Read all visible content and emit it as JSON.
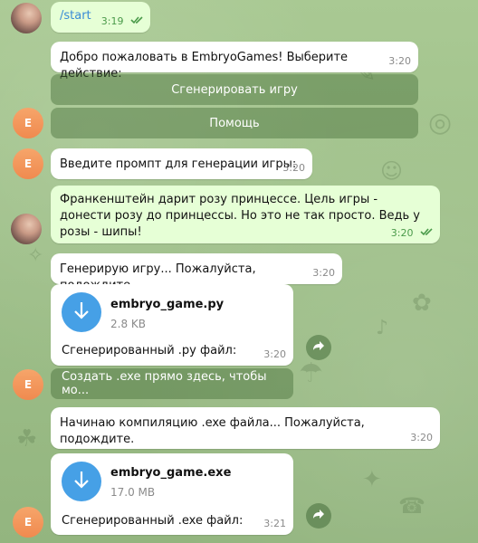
{
  "chat": {
    "messages": [
      {
        "id": "m1",
        "text": "/start",
        "time": "3:19"
      },
      {
        "id": "m2",
        "text": "Добро пожаловать в EmbryoGames! Выберите действие:",
        "time": "3:20"
      },
      {
        "id": "m3",
        "text": "Введите промпт для генерации игры:",
        "time": "3:20"
      },
      {
        "id": "m4",
        "text": "Франкенштейн дарит розу принцессе. Цель игры - донести розу до принцессы. Но это не так просто. Ведь у розы - шипы!",
        "time": "3:20"
      },
      {
        "id": "m5",
        "text": "Генерирую игру... Пожалуйста, подождите.",
        "time": "3:20"
      },
      {
        "id": "m6",
        "file_name": "embryo_game.py",
        "file_size": "2.8 KB",
        "caption": "Сгенерированный .py файл:",
        "time": "3:20"
      },
      {
        "id": "m7",
        "text": "Начинаю компиляцию .exe файла... Пожалуйста, подождите.",
        "time": "3:20"
      },
      {
        "id": "m8",
        "file_name": "embryo_game.exe",
        "file_size": "17.0 MB",
        "caption": "Сгенерированный .exe файл:",
        "time": "3:21"
      }
    ],
    "buttons": [
      {
        "label": "Сгенерировать игру"
      },
      {
        "label": "Помощь"
      },
      {
        "label": "Создать .exe прямо здесь, чтобы мо..."
      }
    ],
    "avatar_letter": "E",
    "colors": {
      "accent": "#46a0e6",
      "incoming": "#ffffff",
      "outgoing": "#e6ffd6",
      "avatar": "#f08a4f"
    }
  }
}
